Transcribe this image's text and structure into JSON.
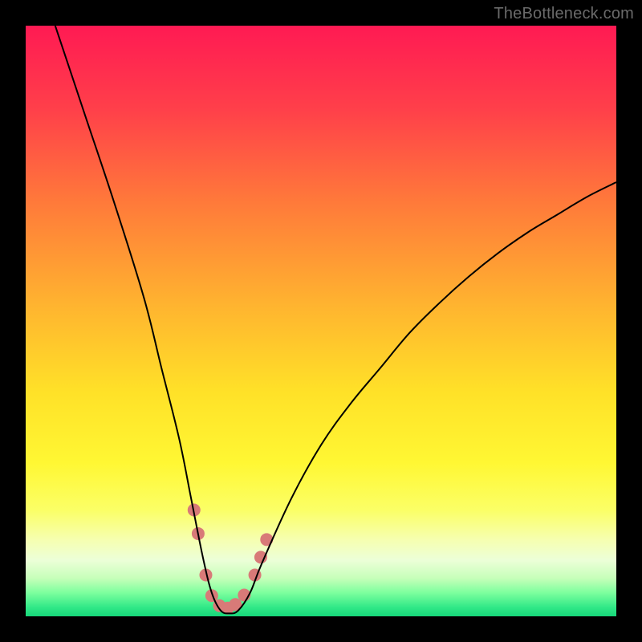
{
  "watermark": "TheBottleneck.com",
  "chart_data": {
    "type": "line",
    "title": "",
    "xlabel": "",
    "ylabel": "",
    "x_range": [
      0,
      100
    ],
    "y_range": [
      0,
      100
    ],
    "series": [
      {
        "name": "bottleneck-curve",
        "x": [
          5,
          10,
          15,
          20,
          23,
          26,
          28,
          30,
          31.5,
          33,
          34.5,
          36,
          38,
          40,
          45,
          50,
          55,
          60,
          65,
          70,
          75,
          80,
          85,
          90,
          95,
          100
        ],
        "y": [
          100,
          85,
          70,
          54,
          42,
          30,
          20,
          10,
          4,
          1,
          0.5,
          1,
          4,
          9,
          20,
          29,
          36,
          42,
          48,
          53,
          57.5,
          61.5,
          65,
          68,
          71,
          73.5
        ],
        "color": "#000000",
        "width": 2
      }
    ],
    "markers": {
      "name": "highlight-dots",
      "color": "#d87a78",
      "radius": 8,
      "points_xy": [
        [
          28.5,
          18
        ],
        [
          29.2,
          14
        ],
        [
          30.5,
          7
        ],
        [
          31.5,
          3.5
        ],
        [
          32.8,
          1.8
        ],
        [
          34.2,
          1.4
        ],
        [
          35.5,
          2.0
        ],
        [
          37.0,
          3.6
        ],
        [
          38.8,
          7
        ],
        [
          39.8,
          10
        ],
        [
          40.8,
          13
        ]
      ]
    },
    "background_gradient": {
      "stops": [
        {
          "offset": 0.0,
          "color": "#ff1a53"
        },
        {
          "offset": 0.14,
          "color": "#ff3f4a"
        },
        {
          "offset": 0.3,
          "color": "#ff7a3a"
        },
        {
          "offset": 0.48,
          "color": "#ffb62f"
        },
        {
          "offset": 0.62,
          "color": "#ffe128"
        },
        {
          "offset": 0.74,
          "color": "#fff733"
        },
        {
          "offset": 0.82,
          "color": "#fbff66"
        },
        {
          "offset": 0.87,
          "color": "#f6ffb0"
        },
        {
          "offset": 0.905,
          "color": "#ecffd8"
        },
        {
          "offset": 0.935,
          "color": "#c7ffba"
        },
        {
          "offset": 0.96,
          "color": "#7dff9e"
        },
        {
          "offset": 0.985,
          "color": "#30e887"
        },
        {
          "offset": 1.0,
          "color": "#17d77a"
        }
      ]
    }
  }
}
